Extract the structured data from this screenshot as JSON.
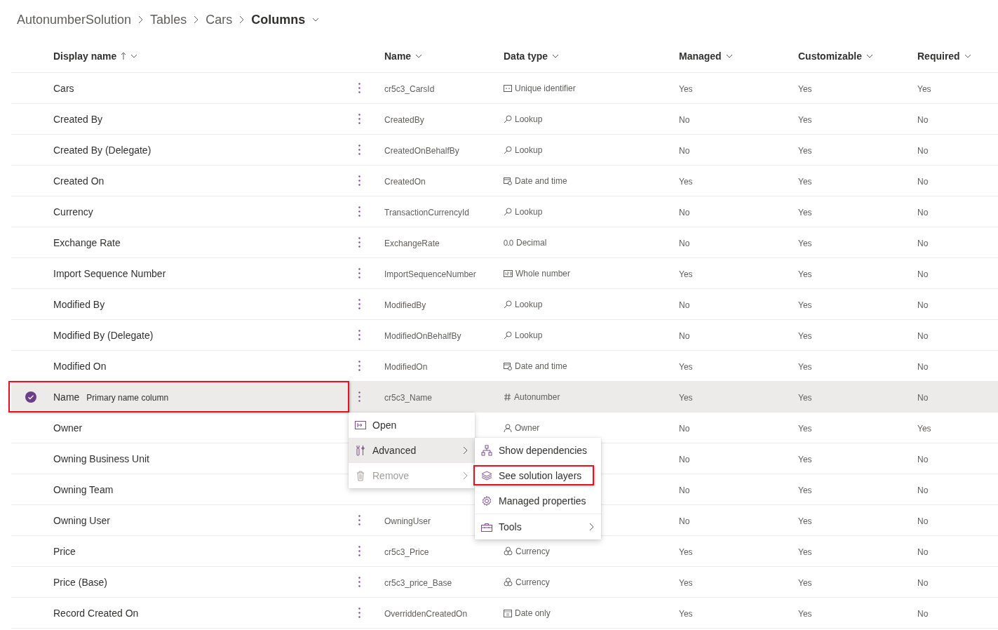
{
  "breadcrumb": [
    {
      "label": "AutonumberSolution",
      "current": false
    },
    {
      "label": "Tables",
      "current": false
    },
    {
      "label": "Cars",
      "current": false
    },
    {
      "label": "Columns",
      "current": true
    }
  ],
  "table": {
    "columns": [
      {
        "label": "Display name",
        "sorted": true
      },
      {
        "label": "Name",
        "sorted": false
      },
      {
        "label": "Data type",
        "sorted": false
      },
      {
        "label": "Managed",
        "sorted": false
      },
      {
        "label": "Customizable",
        "sorted": false
      },
      {
        "label": "Required",
        "sorted": false
      }
    ],
    "rows": [
      {
        "display_name": "Cars",
        "name": "cr5c3_CarsId",
        "data_type": {
          "kind": "id",
          "label": "Unique identifier"
        },
        "managed": "Yes",
        "customizable": "Yes",
        "required": "Yes",
        "selected": false,
        "kebab": true
      },
      {
        "display_name": "Created By",
        "name": "CreatedBy",
        "data_type": {
          "kind": "lookup",
          "label": "Lookup"
        },
        "managed": "No",
        "customizable": "Yes",
        "required": "No",
        "selected": false,
        "kebab": true
      },
      {
        "display_name": "Created By (Delegate)",
        "name": "CreatedOnBehalfBy",
        "data_type": {
          "kind": "lookup",
          "label": "Lookup"
        },
        "managed": "No",
        "customizable": "Yes",
        "required": "No",
        "selected": false,
        "kebab": true
      },
      {
        "display_name": "Created On",
        "name": "CreatedOn",
        "data_type": {
          "kind": "datetime",
          "label": "Date and time"
        },
        "managed": "Yes",
        "customizable": "Yes",
        "required": "No",
        "selected": false,
        "kebab": true
      },
      {
        "display_name": "Currency",
        "name": "TransactionCurrencyId",
        "data_type": {
          "kind": "lookup",
          "label": "Lookup"
        },
        "managed": "No",
        "customizable": "Yes",
        "required": "No",
        "selected": false,
        "kebab": true
      },
      {
        "display_name": "Exchange Rate",
        "name": "ExchangeRate",
        "data_type": {
          "kind": "decimal",
          "label": "Decimal"
        },
        "managed": "No",
        "customizable": "Yes",
        "required": "No",
        "selected": false,
        "kebab": true
      },
      {
        "display_name": "Import Sequence Number",
        "name": "ImportSequenceNumber",
        "data_type": {
          "kind": "whole",
          "label": "Whole number"
        },
        "managed": "Yes",
        "customizable": "Yes",
        "required": "No",
        "selected": false,
        "kebab": true
      },
      {
        "display_name": "Modified By",
        "name": "ModifiedBy",
        "data_type": {
          "kind": "lookup",
          "label": "Lookup"
        },
        "managed": "No",
        "customizable": "Yes",
        "required": "No",
        "selected": false,
        "kebab": true
      },
      {
        "display_name": "Modified By (Delegate)",
        "name": "ModifiedOnBehalfBy",
        "data_type": {
          "kind": "lookup",
          "label": "Lookup"
        },
        "managed": "No",
        "customizable": "Yes",
        "required": "No",
        "selected": false,
        "kebab": true
      },
      {
        "display_name": "Modified On",
        "name": "ModifiedOn",
        "data_type": {
          "kind": "datetime",
          "label": "Date and time"
        },
        "managed": "Yes",
        "customizable": "Yes",
        "required": "No",
        "selected": false,
        "kebab": true
      },
      {
        "display_name": "Name",
        "tag": "Primary name column",
        "name": "cr5c3_Name",
        "data_type": {
          "kind": "autonumber",
          "label": "Autonumber"
        },
        "managed": "Yes",
        "customizable": "Yes",
        "required": "No",
        "selected": true,
        "highlighted": true,
        "kebab": true
      },
      {
        "display_name": "Owner",
        "data_type": {
          "kind": "owner",
          "label": "Owner"
        },
        "managed": "No",
        "customizable": "Yes",
        "required": "Yes",
        "selected": false,
        "kebab": false
      },
      {
        "display_name": "Owning Business Unit",
        "managed": "No",
        "customizable": "Yes",
        "required": "No",
        "selected": false,
        "kebab": false
      },
      {
        "display_name": "Owning Team",
        "managed": "No",
        "customizable": "Yes",
        "required": "No",
        "selected": false,
        "kebab": false
      },
      {
        "display_name": "Owning User",
        "name": "OwningUser",
        "managed": "No",
        "customizable": "Yes",
        "required": "No",
        "selected": false,
        "kebab": true
      },
      {
        "display_name": "Price",
        "name": "cr5c3_Price",
        "data_type": {
          "kind": "currency",
          "label": "Currency"
        },
        "managed": "Yes",
        "customizable": "Yes",
        "required": "No",
        "selected": false,
        "kebab": true
      },
      {
        "display_name": "Price (Base)",
        "name": "cr5c3_price_Base",
        "data_type": {
          "kind": "currency",
          "label": "Currency"
        },
        "managed": "Yes",
        "customizable": "Yes",
        "required": "No",
        "selected": false,
        "kebab": true
      },
      {
        "display_name": "Record Created On",
        "name": "OverriddenCreatedOn",
        "data_type": {
          "kind": "dateonly",
          "label": "Date only"
        },
        "managed": "Yes",
        "customizable": "Yes",
        "required": "No",
        "selected": false,
        "kebab": true
      }
    ]
  },
  "context_menu": {
    "items": [
      {
        "kind": "open",
        "label": "Open",
        "disabled": false,
        "submenu": false,
        "expanded": false
      },
      {
        "kind": "advanced",
        "label": "Advanced",
        "disabled": false,
        "submenu": true,
        "expanded": true
      },
      {
        "kind": "remove",
        "label": "Remove",
        "disabled": true,
        "submenu": true,
        "expanded": false
      }
    ]
  },
  "submenu": {
    "items": [
      {
        "kind": "dependencies",
        "label": "Show dependencies",
        "submenu": false,
        "highlighted": false,
        "divider_after": false
      },
      {
        "kind": "layers",
        "label": "See solution layers",
        "submenu": false,
        "highlighted": true,
        "divider_after": false
      },
      {
        "kind": "gear",
        "label": "Managed properties",
        "submenu": false,
        "highlighted": false,
        "divider_after": true
      },
      {
        "kind": "toolbox",
        "label": "Tools",
        "submenu": true,
        "highlighted": false,
        "divider_after": false
      }
    ]
  }
}
